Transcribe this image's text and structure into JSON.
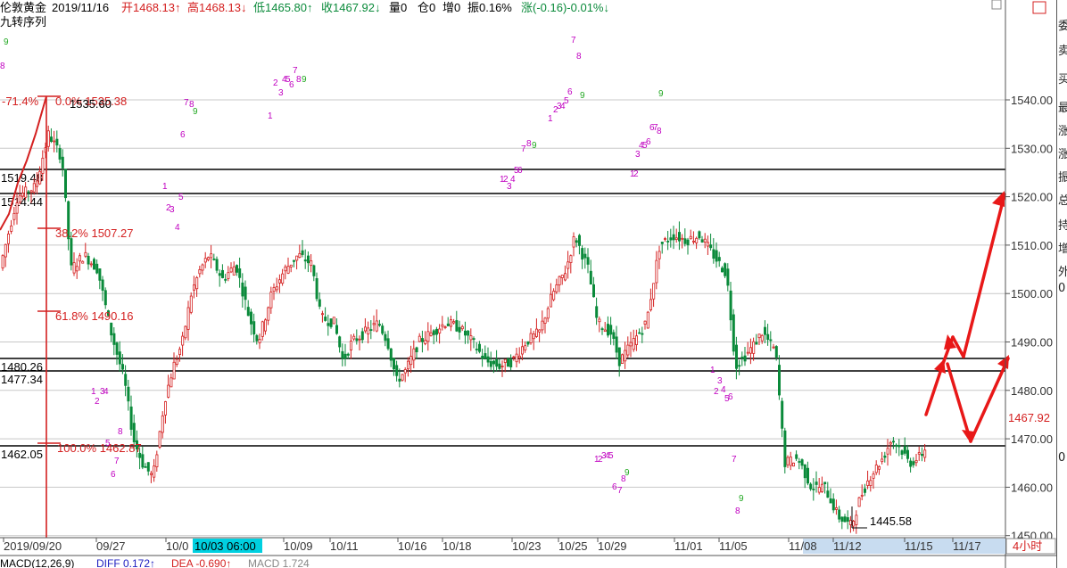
{
  "header": {
    "instrument": "伦敦黄金",
    "date": "2019/11/16",
    "open": "开1468.13↑",
    "high": "高1468.13↓",
    "low": "低1465.80↑",
    "close": "收1467.92↓",
    "volume": "量0",
    "position": "仓0",
    "increase": "增0",
    "amplitude": "振0.16%",
    "change": "涨(-0.16)-0.01%↓",
    "indicator": "九转序列"
  },
  "colors": {
    "up": "#d42020",
    "down": "#0a8a3a",
    "magenta": "#c000c0",
    "green_digit": "#22a822",
    "grid": "#c8c8c8",
    "axis": "#555555",
    "arrow": "#e81818",
    "fib": "#d42020",
    "tag_bg": "#00d0e0",
    "price_tag": "#d42020"
  },
  "y_axis": {
    "ticks": [
      "1540.00",
      "1530.00",
      "1520.00",
      "1510.00",
      "1500.00",
      "1490.00",
      "1480.00",
      "1470.00",
      "1460.00",
      "1450.00"
    ]
  },
  "current_price": "1467.92",
  "horizontal_levels": {
    "labels": [
      "1519.48",
      "1514.44",
      "1480.26",
      "1477.34",
      "1462.05"
    ]
  },
  "fibonacci": {
    "top": "0.0% 1535.38",
    "top_value": "1535.60",
    "r382": "38.2% 1507.27",
    "r618": "61.8% 1490.16",
    "r100": "100.0% 1462.87",
    "left_label": "-71.4%"
  },
  "low_annotation": "1445.58",
  "x_axis": {
    "labels": [
      "2019/09/20",
      "09/27",
      "10/0",
      "10/09",
      "10/11",
      "10/16",
      "10/18",
      "10/23",
      "10/25",
      "10/29",
      "11/01",
      "11/05",
      "11/08",
      "11/12",
      "11/15",
      "11/17"
    ],
    "highlight": "10/03 06:00",
    "period": "4小时"
  },
  "macd": {
    "title": "MACD(12,26,9)",
    "diff": "DIFF 0.172↑",
    "dea": "DEA -0.690↑",
    "macd": "MACD 1.724"
  },
  "right_strip": [
    "委",
    "卖",
    "买",
    "最",
    "涨",
    "涨",
    "振",
    "总",
    "持",
    "增",
    "外",
    "0",
    "0"
  ]
}
